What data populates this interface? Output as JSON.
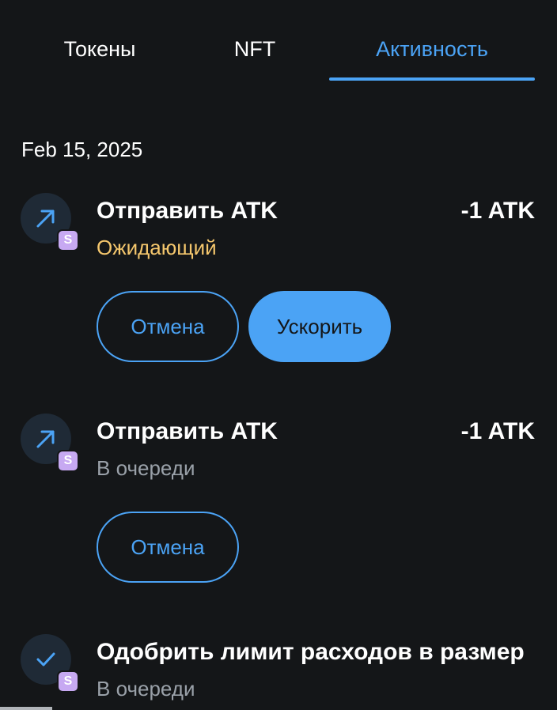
{
  "tabs": [
    {
      "label": "Токены"
    },
    {
      "label": "NFT"
    },
    {
      "label": "Активность"
    }
  ],
  "active_tab": "Активность",
  "colors": {
    "accent": "#4ba3f5",
    "pending": "#f5c76d",
    "queued": "#9aa1a9",
    "badge": "#c7a9f2",
    "background": "#141618"
  },
  "activity": {
    "date": "Feb 15, 2025",
    "items": [
      {
        "icon": "arrow-up-right-icon",
        "badge": "S",
        "title": "Отправить ATK",
        "amount": "-1 ATK",
        "status": "Ожидающий",
        "cancel_label": "Отмена",
        "speedup_label": "Ускорить"
      },
      {
        "icon": "arrow-up-right-icon",
        "badge": "S",
        "title": "Отправить ATK",
        "amount": "-1 ATK",
        "status": "В очереди",
        "cancel_label": "Отмена"
      },
      {
        "icon": "check-icon",
        "badge": "S",
        "title": "Одобрить лимит расходов в размер",
        "status": "В очереди"
      }
    ]
  }
}
